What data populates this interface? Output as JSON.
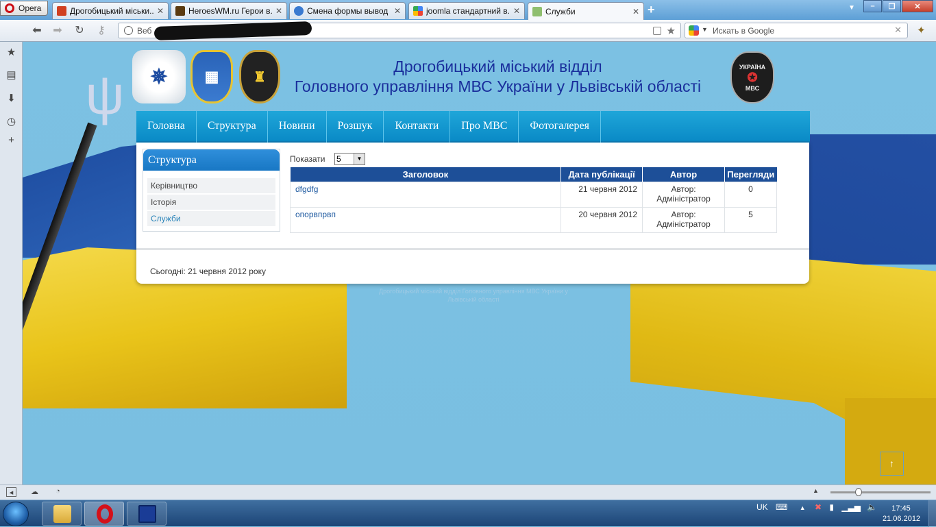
{
  "browser": {
    "menu_label": "Opera",
    "tabs": [
      {
        "title": "Дрогобицький міськи...",
        "favicon_color": "#d04020"
      },
      {
        "title": "HeroesWM.ru Герои в...",
        "favicon_color": "#5a3a10"
      },
      {
        "title": "Смена формы вывод ...",
        "favicon_color": "#3a7ad0"
      },
      {
        "title": "joomla стандартний в...",
        "favicon_color": "#4a90e2"
      },
      {
        "title": "Служби",
        "favicon_color": "#8fbf6f"
      }
    ],
    "address_label": "Веб",
    "search_placeholder": "Искать в Google"
  },
  "site": {
    "title_line1": "Дрогобицький міський відділ",
    "title_line2": "Головного управління МВС України у Львівській області",
    "emblem_right_text": "УКРАЇНА",
    "emblem_right_sub": "МВС",
    "nav": [
      "Головна",
      "Структура",
      "Новини",
      "Розшук",
      "Контакти",
      "Про МВС",
      "Фотогалерея"
    ],
    "sidebar": {
      "heading": "Структура",
      "items": [
        "Керівництво",
        "Історія",
        "Служби"
      ]
    },
    "list": {
      "show_label": "Показати",
      "show_value": "5",
      "headers": [
        "Заголовок",
        "Дата публікації",
        "Автор",
        "Перегляди"
      ],
      "rows": [
        {
          "title": "dfgdfg",
          "date": "21 червня 2012",
          "author": "Автор: Адміністратор",
          "views": "0"
        },
        {
          "title": "опорвпрвп",
          "date": "20 червня 2012",
          "author": "Автор: Адміністратор",
          "views": "5"
        }
      ]
    },
    "today": "Сьогодні: 21 червня 2012 року",
    "footer": "Дрогобицький міський відділ Головного управління МВС України у Львівській області"
  },
  "taskbar": {
    "lang": "UK",
    "time": "17:45",
    "date": "21.06.2012"
  },
  "colors": {
    "nav_bg": "#0a8ac6",
    "table_header": "#1d4f98",
    "title_text": "#1a2f9c"
  }
}
